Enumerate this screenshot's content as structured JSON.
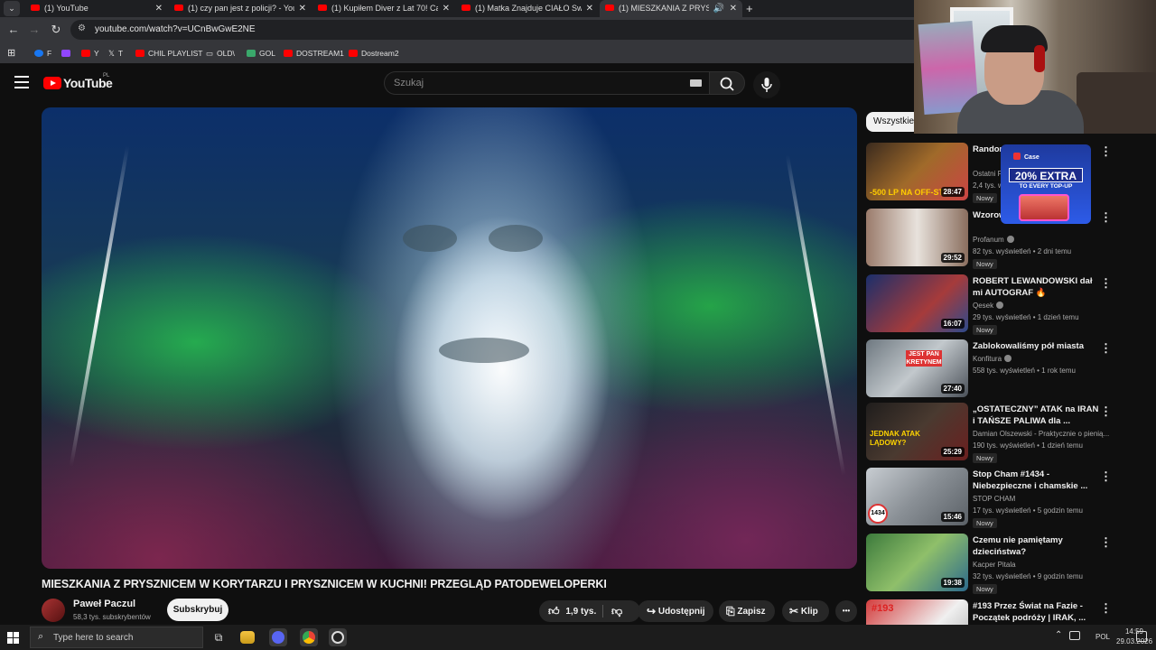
{
  "browser": {
    "tabs": [
      {
        "title": "(1) YouTube",
        "active": false
      },
      {
        "title": "(1) czy pan jest z policji? - YouT",
        "active": false
      },
      {
        "title": "(1) Kupiłem Diver z Lat 70! Casi",
        "active": false
      },
      {
        "title": "(1) Matka Znajduje CIAŁO Swoj",
        "active": false
      },
      {
        "title": "(1) MIESZKANIA Z PRYSZNI",
        "active": true
      }
    ],
    "new_tab": "+",
    "url": "youtube.com/watch?v=UCnBwGwE2NE",
    "bookmarks": [
      {
        "label": "F",
        "icon": "facebook-icon",
        "color": "#1877f2"
      },
      {
        "label": "",
        "icon": "twitch-icon",
        "color": "#9146ff"
      },
      {
        "label": "Y",
        "icon": "youtube-icon",
        "color": "#ff0000"
      },
      {
        "label": "T",
        "icon": "x-icon",
        "color": "#ffffff"
      },
      {
        "label": "CHIL PLAYLIST",
        "icon": "youtube-icon",
        "color": "#ff0000"
      },
      {
        "label": "OLD\\",
        "icon": "folder-icon",
        "color": "#cccccc"
      },
      {
        "label": "GOL",
        "icon": "gol-icon",
        "color": "#3aa86b"
      },
      {
        "label": "DOSTREAM1",
        "icon": "youtube-icon",
        "color": "#ff0000"
      },
      {
        "label": "Dostream2",
        "icon": "youtube-icon",
        "color": "#ff0000"
      }
    ]
  },
  "youtube": {
    "logo": "YouTube",
    "region": "PL",
    "search_placeholder": "Szukaj"
  },
  "video": {
    "title": "MIESZKANIA Z PRYSZNICEM W KORYTARZU I PRYSZNICEM W KUCHNI! PRZEGLĄD PATODEWELOPERKI",
    "channel": "Paweł Paczul",
    "subscribers": "58,3 tys. subskrybentów",
    "subscribe_label": "Subskrybuj",
    "likes": "1,9 tys.",
    "share_label": "Udostępnij",
    "save_label": "Zapisz",
    "clip_label": "Klip",
    "more_label": "•••"
  },
  "sidebar": {
    "chip": "Wszystkie",
    "items": [
      {
        "title": "Random minuto",
        "channel": "Ostatni P",
        "meta": "2,4 tys. w",
        "new": "Nowy",
        "duration": "28:47",
        "thumb": "#5a3b2a",
        "thumb_text": "-500 LP NA OFF-STI"
      },
      {
        "title": "Wzorow Odciął ojcu",
        "channel": "Profanum",
        "meta": "82 tys. wyświetleń • 2 dni temu",
        "new": "Nowy",
        "duration": "29:52",
        "thumb": "#8a7266",
        "thumb_text": ""
      },
      {
        "title": "ROBERT LEWANDOWSKI dał mi AUTOGRAF 🔥",
        "channel": "Qesek",
        "meta": "29 tys. wyświetleń • 1 dzień temu",
        "new": "Nowy",
        "duration": "16:07",
        "thumb": "#3b4f8c",
        "thumb_text": ""
      },
      {
        "title": "Zablokowaliśmy pół miasta",
        "channel": "Konfitura",
        "meta": "558 tys. wyświetleń • 1 rok temu",
        "new": "",
        "duration": "27:40",
        "thumb": "#7a8189",
        "thumb_text": "JEST PAN KRETYNEM"
      },
      {
        "title": "„OSTATECZNY” ATAK na IRAN i TAŃSZE PALIWA dla ...",
        "channel": "Damian Olszewski - Praktycznie o pienią...",
        "meta": "190 tys. wyświetleń • 1 dzień temu",
        "new": "Nowy",
        "duration": "25:29",
        "thumb": "#2d2a28",
        "thumb_text": "JEDNAK ATAK LĄDOWY?"
      },
      {
        "title": "Stop Cham #1434 - Niebezpieczne i chamskie ...",
        "channel": "STOP CHAM",
        "meta": "17 tys. wyświetleń • 5 godzin temu",
        "new": "Nowy",
        "duration": "15:46",
        "thumb": "#9aa0a6",
        "thumb_text": "1434"
      },
      {
        "title": "Czemu nie pamiętamy dzieciństwa?",
        "channel": "Kacper Pitala",
        "meta": "32 tys. wyświetleń • 9 godzin temu",
        "new": "Nowy",
        "duration": "19:38",
        "thumb": "#4f8a4f",
        "thumb_text": ""
      },
      {
        "title": "#193 Przez Świat na Fazie - Początek podróży | IRAK, ...",
        "channel": "",
        "meta": "",
        "new": "",
        "duration": "",
        "thumb": "#d33d3d",
        "thumb_text": "#193"
      }
    ]
  },
  "ad": {
    "brand": "Case",
    "headline": "20% EXTRA",
    "sub": "TO EVERY TOP-UP"
  },
  "taskbar": {
    "search_placeholder": "Type here to search",
    "lang": "POL",
    "time": "14:59",
    "date": "29.03.2026"
  }
}
